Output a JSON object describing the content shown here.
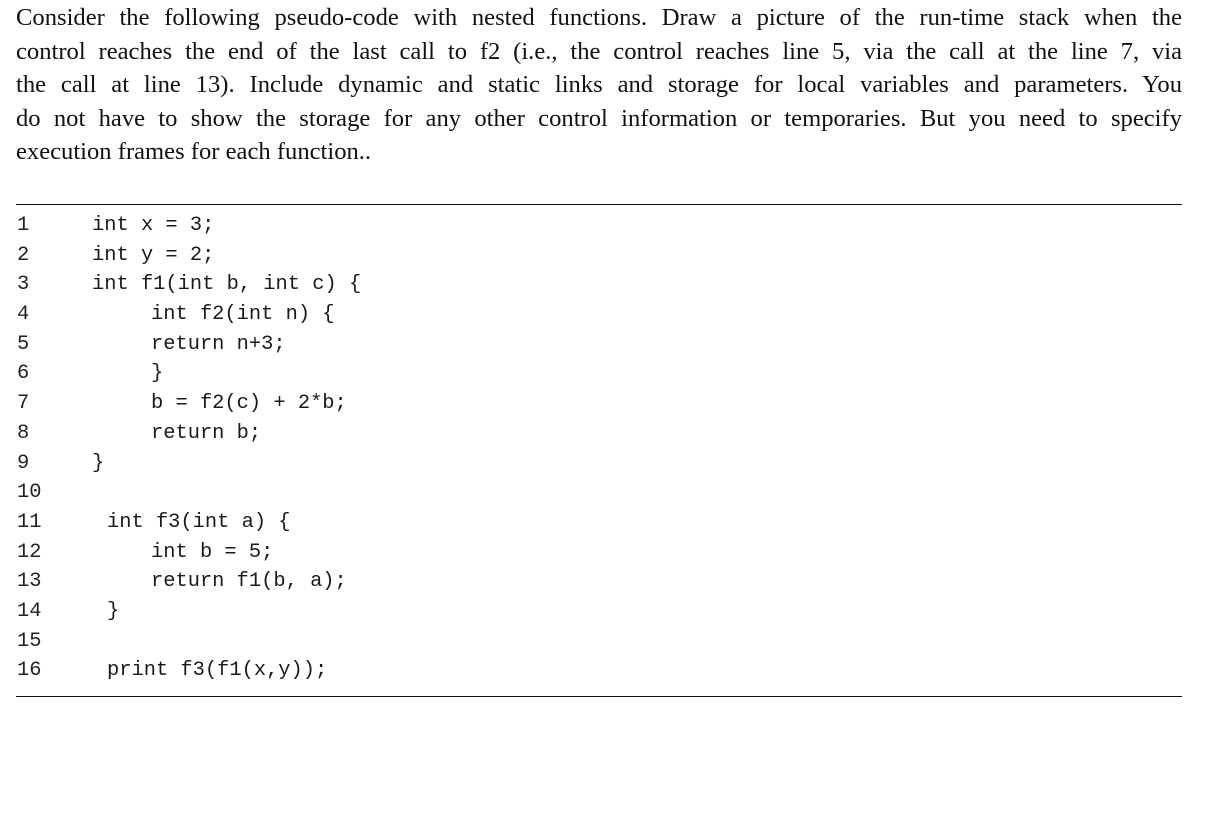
{
  "question": {
    "text": "Consider the following pseudo-code with nested functions. Draw a picture of the run-time stack when the control reaches the end of the last call to f2 (i.e., the control reaches line 5, via the call at the line 7, via the call at line 13). Include dynamic and static links and storage for local variables and parameters. You do not have to show the storage for any other control information or temporaries. But you need to specify execution frames for each function..",
    "lines": [
      "Consider the following pseudo-code with nested functions. Draw a picture of the run-time stack when the",
      "control reaches the end of the last call to f2 (i.e., the control reaches line 5, via the call at the line 7, via",
      "the call at line 13). Include dynamic and static links and storage for local variables and parameters. You",
      "do not have to show the storage for any other control information or temporaries. But you need to specify",
      "execution frames for each function.."
    ]
  },
  "code": {
    "lines": [
      {
        "number": "1",
        "text": "int x = 3;"
      },
      {
        "number": "2",
        "text": "int y = 2;"
      },
      {
        "number": "3",
        "text": "int f1(int b, int c) {"
      },
      {
        "number": "4",
        "text": "int f2(int n) {"
      },
      {
        "number": "5",
        "text": "return n+3;"
      },
      {
        "number": "6",
        "text": "}"
      },
      {
        "number": "7",
        "text": "b = f2(c) + 2*b;"
      },
      {
        "number": "8",
        "text": "return b;"
      },
      {
        "number": "9",
        "text": "}"
      },
      {
        "number": "10",
        "text": ""
      },
      {
        "number": "11",
        "text": "int f3(int a) {"
      },
      {
        "number": "12",
        "text": "int b = 5;"
      },
      {
        "number": "13",
        "text": "return f1(b, a);"
      },
      {
        "number": "14",
        "text": "}"
      },
      {
        "number": "15",
        "text": ""
      },
      {
        "number": "16",
        "text": "print f3(f1(x,y));"
      }
    ]
  }
}
